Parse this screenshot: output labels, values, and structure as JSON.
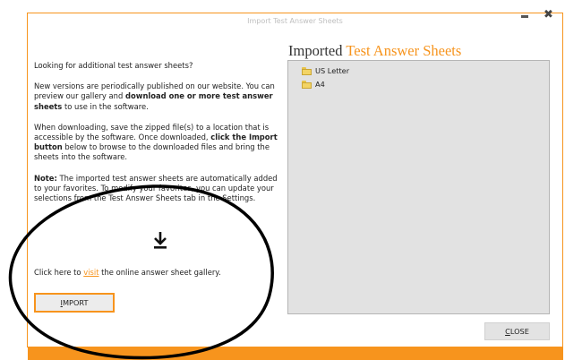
{
  "window": {
    "title": "Import Test Answer Sheets",
    "accent_color": "#f7941d"
  },
  "left_panel": {
    "intro": "Looking for additional test answer sheets?",
    "para1_a": "New versions are periodically published on our website.  You can preview our gallery and ",
    "para1_bold": "download one or more test answer sheets",
    "para1_b": " to use in the software.",
    "para2_a": "When downloading, save the zipped file(s) to a location that is accessible by the software.  Once downloaded, ",
    "para2_bold": "click the Import button",
    "para2_b": " below to browse to the downloaded files and bring the sheets into the software.",
    "note_label": "Note:",
    "note_text": " The imported test answer sheets are automatically added to your favorites.  To modify your favorites, you can update your selections from the Test Answer Sheets tab in the Settings.",
    "download_icon": "download-arrow-icon",
    "visit_prefix": "Click here to ",
    "visit_link": "visit",
    "visit_suffix": " the online answer sheet gallery.",
    "import_button_first": "I",
    "import_button_rest": "MPORT"
  },
  "right_panel": {
    "title_main": "Imported ",
    "title_accent": "Test Answer Sheets",
    "items": [
      {
        "label": "US Letter",
        "icon": "folder-icon"
      },
      {
        "label": "A4",
        "icon": "folder-icon"
      }
    ],
    "close_button_first": "C",
    "close_button_rest": "LOSE"
  }
}
